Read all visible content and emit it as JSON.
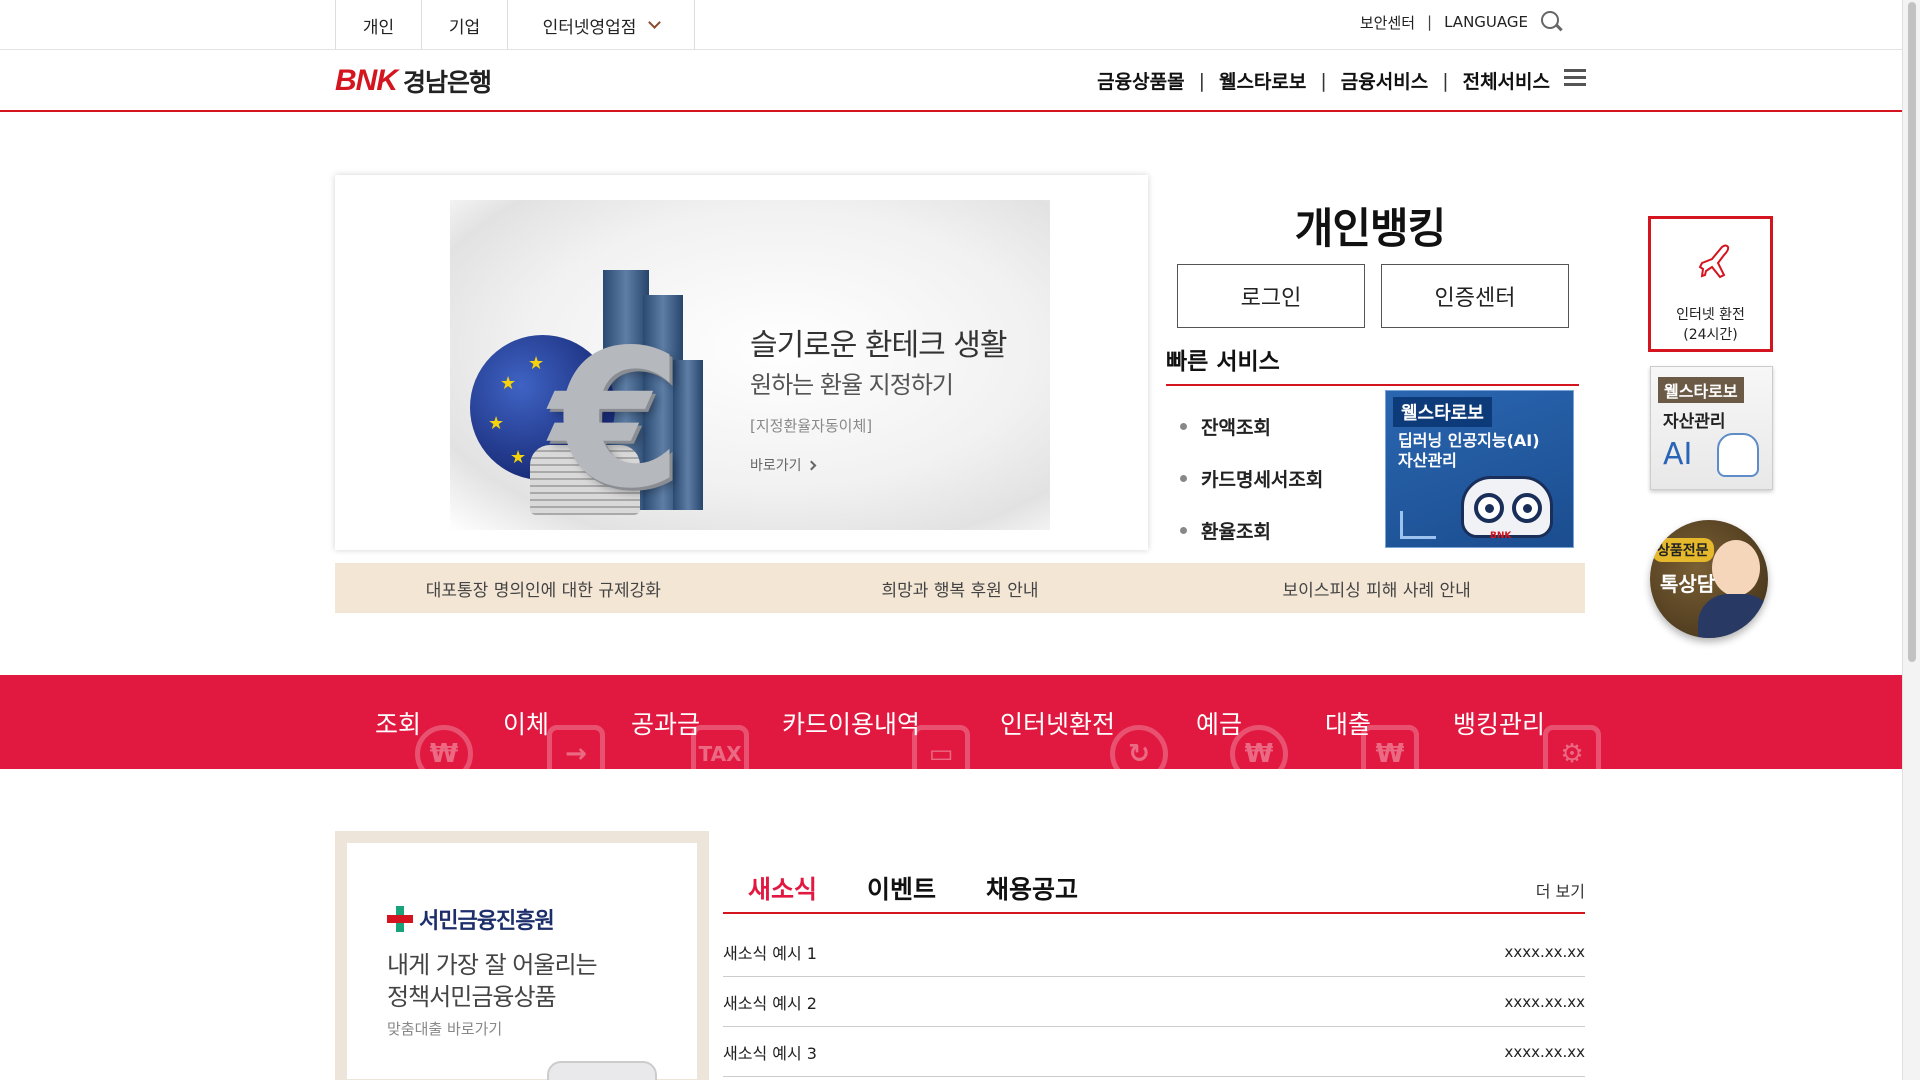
{
  "topbar": {
    "tabs": [
      "개인",
      "기업",
      "인터넷영업점"
    ],
    "security_center": "보안센터",
    "separator": "|",
    "language": "LANGUAGE"
  },
  "header": {
    "logo_mark": "BNK",
    "logo_text": "경남은행",
    "nav": [
      "금융상품몰",
      "웰스타로보",
      "금융서비스",
      "전체서비스"
    ],
    "nav_separator": "|"
  },
  "banner": {
    "title": "슬기로운 환테크 생활",
    "subtitle": "원하는 환율 지정하기",
    "note": "[지정환율자동이체]",
    "link": "바로가기"
  },
  "personal_banking": {
    "title": "개인뱅킹",
    "login": "로그인",
    "cert_center": "인증센터",
    "quick_title": "빠른 서비스",
    "quick_items": [
      "잔액조회",
      "카드명세서조회",
      "환율조회"
    ],
    "robo_tag": "웰스타로보",
    "robo_desc_1": "딥러닝 인공지능(AI)",
    "robo_desc_2": "자산관리",
    "robo_badge": "BNK"
  },
  "notices": [
    "대포통장 명의인에 대한 규제강화",
    "희망과 행복 후원 안내",
    "보이스피싱 피해 사례 안내"
  ],
  "rail": {
    "exchange_1": "인터넷 환전",
    "exchange_2": "(24시간)",
    "robo_tag": "웰스타로보",
    "robo_sub": "자산관리",
    "robo_ai": "AI",
    "chat_tag": "상품전문",
    "chat_text": "톡상담"
  },
  "menu": [
    {
      "label": "조회",
      "icon": "₩"
    },
    {
      "label": "이체",
      "icon": "→"
    },
    {
      "label": "공과금",
      "icon": "TAX"
    },
    {
      "label": "카드이용내역",
      "icon": "▭"
    },
    {
      "label": "인터넷환전",
      "icon": "↻"
    },
    {
      "label": "예금",
      "icon": "₩"
    },
    {
      "label": "대출",
      "icon": "₩"
    },
    {
      "label": "뱅킹관리",
      "icon": "⚙"
    }
  ],
  "promo": {
    "logo": "서민금융진흥원",
    "line1": "내게 가장 잘 어울리는",
    "line2": "정책서민금융상품",
    "line3": "맞춤대출 바로가기"
  },
  "news": {
    "tabs": [
      "새소식",
      "이벤트",
      "채용공고"
    ],
    "more": "더 보기",
    "items": [
      {
        "title": "새소식 예시 1",
        "date": "xxxx.xx.xx"
      },
      {
        "title": "새소식 예시 2",
        "date": "xxxx.xx.xx"
      },
      {
        "title": "새소식 예시 3",
        "date": "xxxx.xx.xx"
      }
    ]
  },
  "colors": {
    "brand_red": "#d4141f",
    "menu_band": "#e11940",
    "notice_bg": "#f3e6d5"
  }
}
